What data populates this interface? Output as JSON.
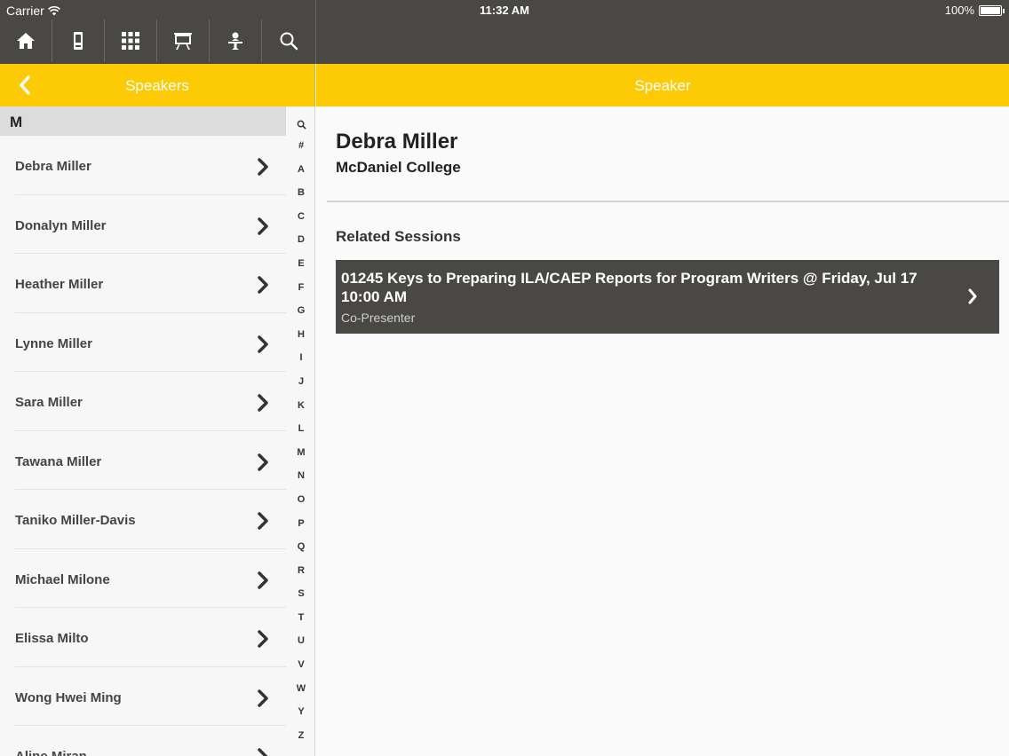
{
  "status_bar": {
    "carrier": "Carrier",
    "time": "11:32 AM",
    "battery": "100%"
  },
  "toolbar": {
    "items": [
      {
        "icon": "home-icon"
      },
      {
        "icon": "phone-icon"
      },
      {
        "icon": "grid-icon"
      },
      {
        "icon": "presentation-icon"
      },
      {
        "icon": "speaker-icon"
      },
      {
        "icon": "search-icon"
      }
    ]
  },
  "left_header": {
    "title": "Speakers"
  },
  "right_header": {
    "title": "Speaker"
  },
  "speaker_list": {
    "section_letter": "M",
    "items": [
      "Debra Miller",
      "Donalyn Miller",
      "Heather Miller",
      "Lynne Miller",
      "Sara Miller",
      "Tawana Miller",
      "Taniko Miller-Davis",
      "Michael Milone",
      "Elissa Milto",
      "Wong Hwei Ming",
      "Aline Miran"
    ]
  },
  "alpha_index": [
    "#",
    "A",
    "B",
    "C",
    "D",
    "E",
    "F",
    "G",
    "H",
    "I",
    "J",
    "K",
    "L",
    "M",
    "N",
    "O",
    "P",
    "Q",
    "R",
    "S",
    "T",
    "U",
    "V",
    "W",
    "Y",
    "Z"
  ],
  "detail": {
    "name": "Debra Miller",
    "organization": "McDaniel College",
    "related_title": "Related Sessions",
    "sessions": [
      {
        "title": "01245 Keys to Preparing ILA/CAEP Reports for Program Writers @ Friday, Jul 17 10:00 AM",
        "role": "Co-Presenter"
      }
    ]
  },
  "colors": {
    "dark_bar": "#4a4845",
    "accent_yellow": "#fdcb05"
  }
}
